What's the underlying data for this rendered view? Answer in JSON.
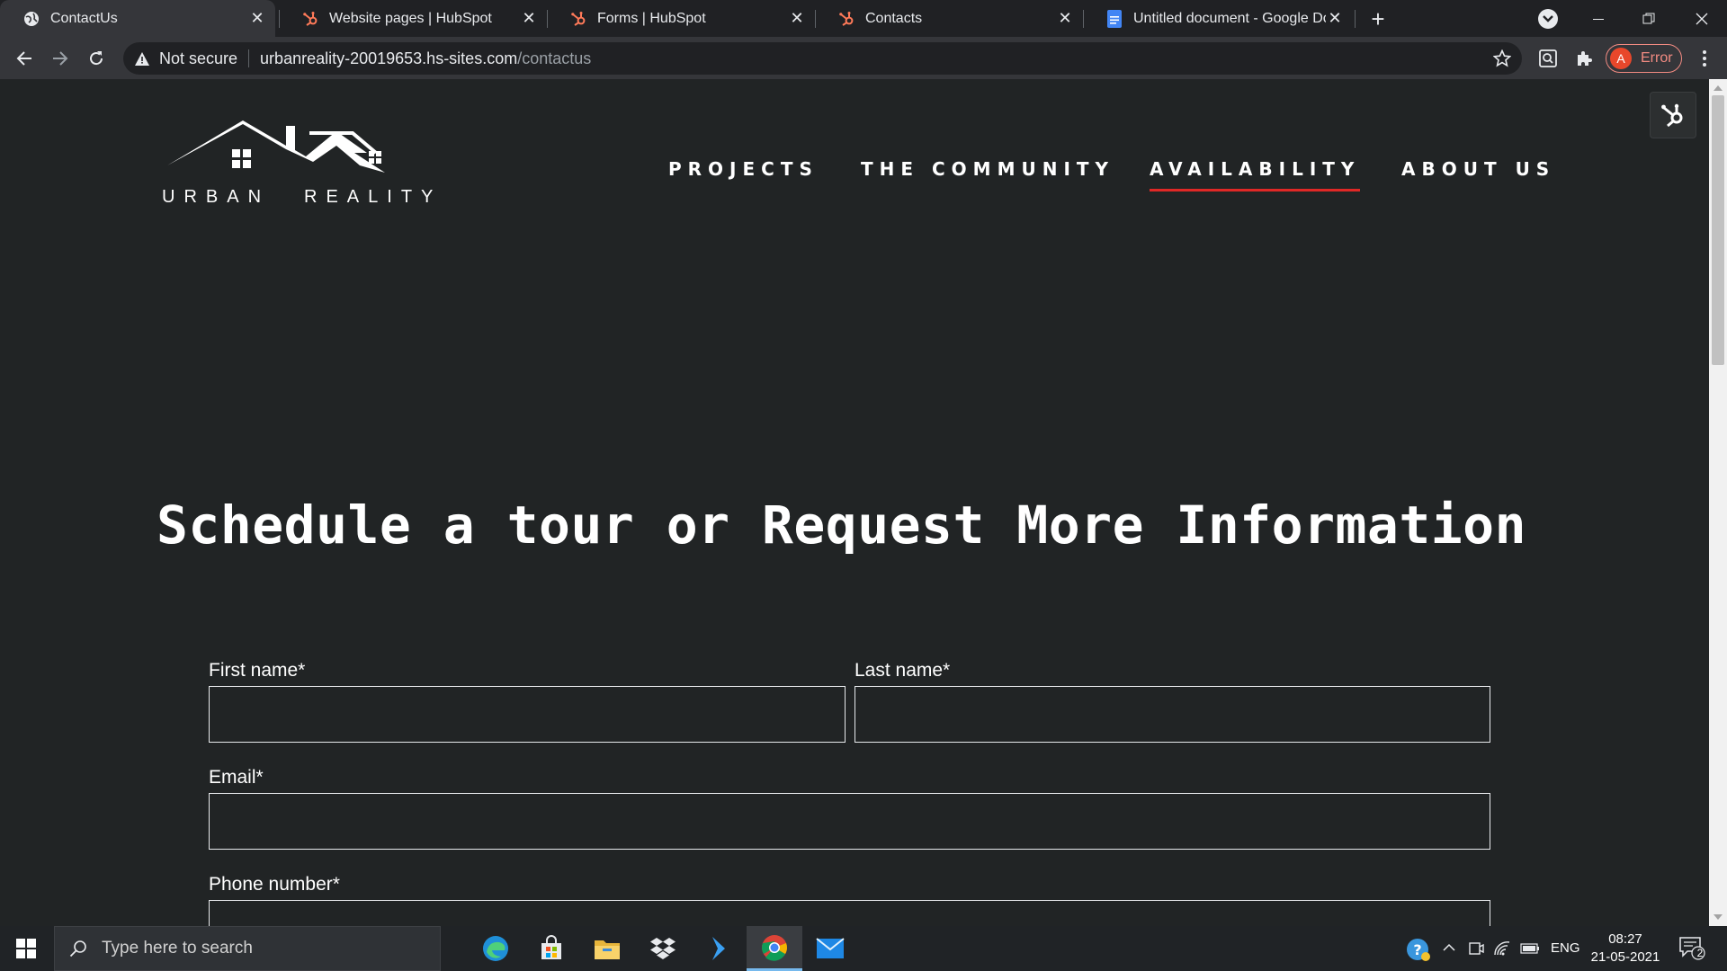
{
  "browser": {
    "tabs": [
      {
        "title": "ContactUs",
        "favicon": "globe-icon",
        "active": true
      },
      {
        "title": "Website pages | HubSpot",
        "favicon": "hubspot-icon",
        "active": false
      },
      {
        "title": "Forms | HubSpot",
        "favicon": "hubspot-icon",
        "active": false
      },
      {
        "title": "Contacts",
        "favicon": "hubspot-icon",
        "active": false
      },
      {
        "title": "Untitled document - Google Docs",
        "favicon": "google-docs-icon",
        "active": false
      }
    ],
    "security_label": "Not secure",
    "url_host": "urbanreality-20019653.hs-sites.com",
    "url_path": "/contactus",
    "profile_initial": "A",
    "profile_status": "Error"
  },
  "site": {
    "logo": {
      "word1": "URBAN",
      "word2": "REALITY"
    },
    "nav": [
      {
        "label": "PROJECTS",
        "active": false
      },
      {
        "label": "THE COMMUNITY",
        "active": false
      },
      {
        "label": "AVAILABILITY",
        "active": true
      },
      {
        "label": "ABOUT US",
        "active": false
      }
    ],
    "accent_color": "#e02826",
    "headline": "Schedule a tour or Request More Information",
    "form": {
      "first_name_label": "First name*",
      "last_name_label": "Last name*",
      "email_label": "Email*",
      "phone_label": "Phone number*",
      "first_name_value": "",
      "last_name_value": "",
      "email_value": "",
      "phone_value": ""
    }
  },
  "taskbar": {
    "search_placeholder": "Type here to search",
    "apps": [
      "edge-icon",
      "store-icon",
      "file-explorer-icon",
      "dropbox-icon",
      "visual-studio-icon",
      "chrome-icon",
      "mail-icon"
    ],
    "language": "ENG",
    "time": "08:27",
    "date": "21-05-2021",
    "notification_count": "2"
  }
}
